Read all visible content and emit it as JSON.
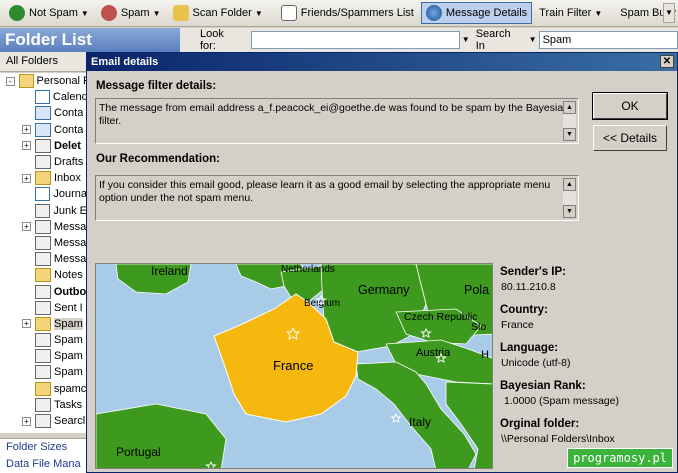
{
  "toolbar": {
    "not_spam": "Not Spam",
    "spam": "Spam",
    "scan_folder": "Scan Folder",
    "friends_list": "Friends/Spammers List",
    "message_details": "Message Details",
    "train_filter": "Train Filter",
    "spam_bully": "Spam Bully"
  },
  "folder_list": {
    "title": "Folder List",
    "all_folders": "All Folders",
    "items": [
      {
        "label": "Personal F",
        "icon": "personal-folders-icon",
        "expand": "-",
        "root": true
      },
      {
        "label": "Calend",
        "icon": "calendar-icon",
        "expand": ""
      },
      {
        "label": "Conta",
        "icon": "contacts-icon",
        "expand": ""
      },
      {
        "label": "Conta",
        "icon": "contacts-icon",
        "expand": "+"
      },
      {
        "label": "Delet",
        "icon": "deleted-items-icon",
        "expand": "+",
        "bold": true
      },
      {
        "label": "Drafts",
        "icon": "drafts-icon",
        "expand": ""
      },
      {
        "label": "Inbox",
        "icon": "inbox-icon",
        "expand": "+"
      },
      {
        "label": "Journa",
        "icon": "journal-icon",
        "expand": ""
      },
      {
        "label": "Junk E",
        "icon": "junk-icon",
        "expand": ""
      },
      {
        "label": "Messa",
        "icon": "message-icon",
        "expand": "+"
      },
      {
        "label": "Messa",
        "icon": "message-icon",
        "expand": ""
      },
      {
        "label": "Messa",
        "icon": "message-icon",
        "expand": ""
      },
      {
        "label": "Notes",
        "icon": "notes-icon",
        "expand": ""
      },
      {
        "label": "Outbo",
        "icon": "outbox-icon",
        "expand": "",
        "bold": true
      },
      {
        "label": "Sent I",
        "icon": "sent-items-icon",
        "expand": ""
      },
      {
        "label": "Spam",
        "icon": "folder-icon",
        "expand": "+",
        "selected": true
      },
      {
        "label": "Spam",
        "icon": "message-icon",
        "expand": ""
      },
      {
        "label": "Spam",
        "icon": "message-icon",
        "expand": ""
      },
      {
        "label": "Spam",
        "icon": "message-icon",
        "expand": ""
      },
      {
        "label": "spamc",
        "icon": "folder-icon",
        "expand": ""
      },
      {
        "label": "Tasks",
        "icon": "tasks-icon",
        "expand": ""
      },
      {
        "label": "Searcl",
        "icon": "search-folders-icon",
        "expand": "+"
      }
    ],
    "links": [
      "Folder Sizes",
      "Data File Mana"
    ]
  },
  "lookbar": {
    "look_for": "Look for:",
    "search_in": "Search In",
    "search_value": "Spam"
  },
  "dialog": {
    "title": "Email details",
    "filter_heading": "Message filter details:",
    "filter_text": "The message from email address a_f.peacock_ei@goethe.de was found to be spam by the Bayesian filter.",
    "recommend_heading": "Our Recommendation:",
    "recommend_text": "If you consider this email good, please learn it as a good email by selecting the appropriate menu option under the not spam menu.",
    "ok": "OK",
    "details": "<< Details",
    "map_labels": {
      "ireland": "Ireland",
      "netherlands": "Netherlands",
      "belgium": "Belgium",
      "germany": "Germany",
      "poland": "Pola",
      "czech": "Czech Republic",
      "slovakia": "Slo",
      "austria": "Austria",
      "hungary": "H",
      "france": "France",
      "italy": "Italy",
      "portugal": "Portugal"
    },
    "sender_ip_label": "Sender's IP:",
    "sender_ip": "80.11.210.8",
    "country_label": "Country:",
    "country": "France",
    "language_label": "Language:",
    "language": "Unicode (utf-8)",
    "rank_label": "Bayesian Rank:",
    "rank": "1.0000 (Spam message)",
    "folder_label": "Orginal folder:",
    "folder": "\\\\Personal Folders\\Inbox"
  },
  "watermark": "programosy.pl",
  "colors": {
    "france": "#f6b80f",
    "land": "#3d9a1e",
    "sea": "#a8cbe8",
    "title_bar": "#0a246a"
  }
}
